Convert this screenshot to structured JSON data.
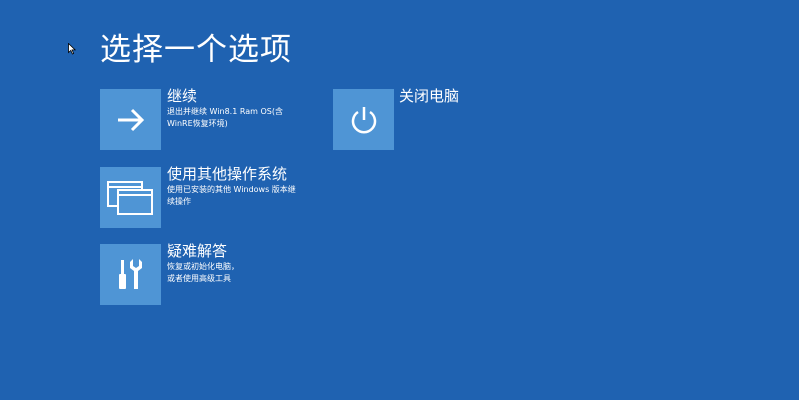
{
  "page_title": "选择一个选项",
  "options": [
    {
      "title": "继续",
      "description_line1": "退出并继续 Win8.1 Ram OS(含",
      "description_line2": "WinRE恢复环境)",
      "icon": "arrow-right-icon"
    },
    {
      "title": "使用其他操作系统",
      "description_line1": "使用已安装的其他 Windows 版本继",
      "description_line2": "续操作",
      "icon": "windows-icon"
    },
    {
      "title": "疑难解答",
      "description_line1": "恢复或初始化电脑，",
      "description_line2": "或者使用高级工具",
      "icon": "tools-icon"
    },
    {
      "title": "关闭电脑",
      "icon": "power-icon"
    }
  ],
  "colors": {
    "background": "#1f62b1",
    "tile": "#4f95d5",
    "text": "#ffffff"
  }
}
